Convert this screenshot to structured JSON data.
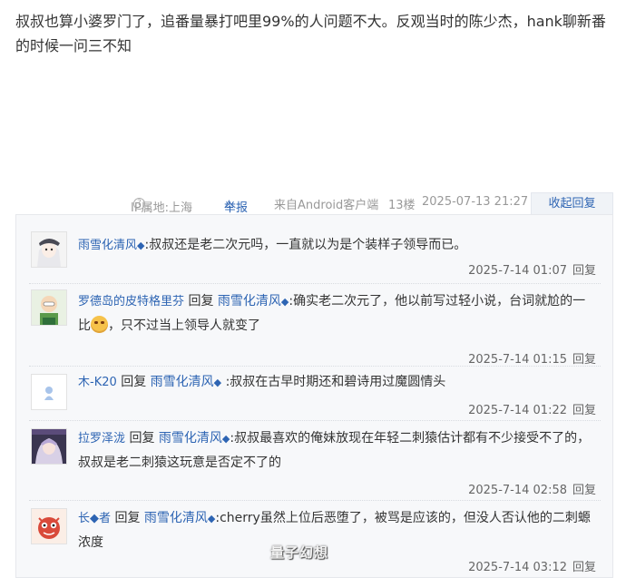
{
  "post": {
    "text": "叔叔也算小婆罗门了，追番量暴打吧里99%的人问题不大。反观当时的陈少杰，hank聊新番的时候一问三不知"
  },
  "meta": {
    "ip_label": "IP属地:上海",
    "report_label": "举报",
    "client": "来自Android客户端",
    "floor": "13楼",
    "time": "2025-07-13 21:27",
    "collapse_label": "收起回复"
  },
  "replies": [
    {
      "user": "雨雪化清风",
      "reply_prefix": "",
      "reply_to": "",
      "text": ":叔叔还是老二次元吗，一直就以为是个装样子领导而已。",
      "text_after_emoji": "",
      "time": "2025-7-14 01:07",
      "reply_label": "回复",
      "avatar_icon": "anime-girl-avatar"
    },
    {
      "user": "罗德岛的皮特格里芬",
      "reply_prefix": "回复",
      "reply_to": "雨雪化清风",
      "text": ":确实老二次元了，他以前写过轻小说，台词就尬的一比",
      "text_after_emoji": "，只不过当上领导人就变了",
      "time": "2025-7-14 01:15",
      "reply_label": "回复",
      "avatar_icon": "cartoon-avatar"
    },
    {
      "user": "木-K20",
      "reply_prefix": "回复",
      "reply_to": "雨雪化清风",
      "text": ":叔叔在古早时期还和碧诗用过魔圆情头",
      "text_after_emoji": "",
      "time": "2025-7-14 01:22",
      "reply_label": "回复",
      "avatar_icon": "small-figure-avatar"
    },
    {
      "user": "拉罗泽泷",
      "reply_prefix": "回复",
      "reply_to": "雨雪化清风",
      "text": ":叔叔最喜欢的俺妹放现在年轻二刺猿估计都有不少接受不了的，叔叔是老二刺猿这玩意是否定不了的",
      "text_after_emoji": "",
      "time": "2025-7-14 02:58",
      "reply_label": "回复",
      "avatar_icon": "anime-character-avatar"
    },
    {
      "user": "长◆者",
      "reply_prefix": "回复",
      "reply_to": "雨雪化清风",
      "text": ":cherry虽然上位后恶堕了，被骂是应该的，但没人否认他的二刺螈浓度",
      "text_after_emoji": "",
      "time": "2025-7-14 03:12",
      "reply_label": "回复",
      "avatar_icon": "red-creature-avatar"
    }
  ],
  "watermark": "量子幻想",
  "colors": {
    "link": "#2d64b3",
    "reply_bg": "#f7f8fa",
    "meta_text": "#999999"
  }
}
